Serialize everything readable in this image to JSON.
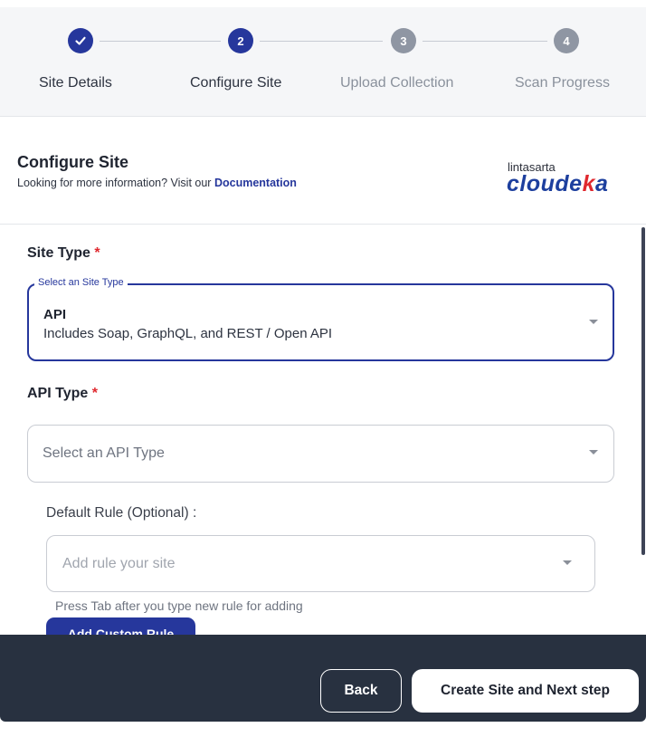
{
  "stepper": {
    "steps": [
      {
        "number": "",
        "label": "Site Details",
        "status": "completed"
      },
      {
        "number": "2",
        "label": "Configure Site",
        "status": "current"
      },
      {
        "number": "3",
        "label": "Upload Collection",
        "status": "pending"
      },
      {
        "number": "4",
        "label": "Scan Progress",
        "status": "pending"
      }
    ]
  },
  "header": {
    "title": "Configure Site",
    "subtitle_prefix": "Looking for more information? Visit our",
    "subtitle_link": "Documentation",
    "logo_small": "lintasarta",
    "logo_main_part1": "cloude",
    "logo_main_accent": "k",
    "logo_main_part2": "a"
  },
  "site_type": {
    "label": "Site Type",
    "required_mark": "*",
    "legend": "Select an Site Type",
    "value_title": "API",
    "value_description": "Includes Soap, GraphQL, and REST / Open API"
  },
  "api_type": {
    "label": "API Type",
    "required_mark": "*",
    "placeholder": "Select an API Type"
  },
  "default_rule": {
    "label": "Default Rule (Optional) :",
    "placeholder": "Add rule your site",
    "hint": "Press Tab after you type new rule for adding",
    "add_button": "Add Custom Rule"
  },
  "footer": {
    "back": "Back",
    "next": "Create Site and Next step"
  },
  "colors": {
    "primary": "#26379c",
    "footer_bg": "#283140",
    "required": "#e0292f",
    "logo_blue": "#1d3f9e"
  },
  "icons": [
    "checkmark-icon",
    "chevron-down-icon"
  ]
}
